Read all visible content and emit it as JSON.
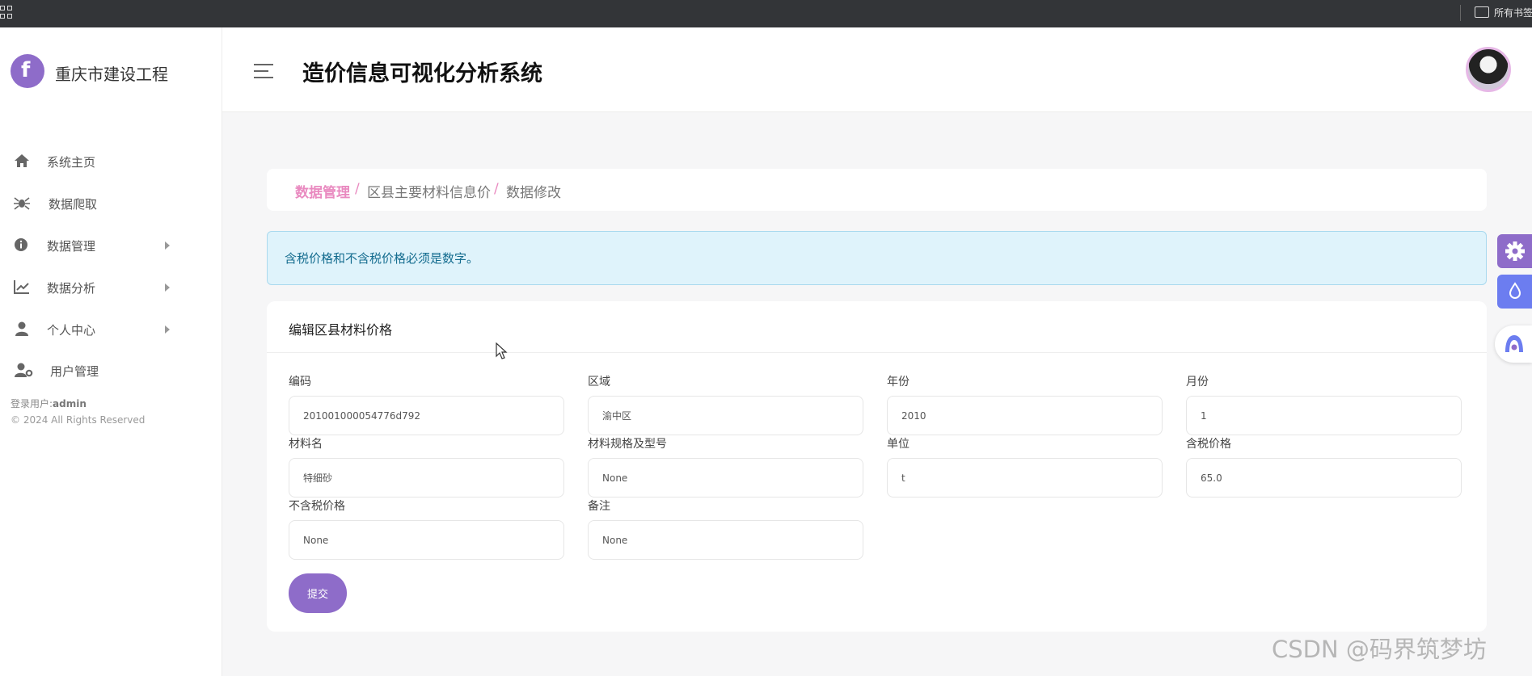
{
  "browser": {
    "bookmarks_label": "所有书签"
  },
  "sidebar": {
    "brand": "重庆市建设工程",
    "items": [
      {
        "label": "系统主页",
        "icon": "home-icon",
        "has_submenu": false
      },
      {
        "label": "数据爬取",
        "icon": "spider-icon",
        "has_submenu": false
      },
      {
        "label": "数据管理",
        "icon": "info-icon",
        "has_submenu": true
      },
      {
        "label": "数据分析",
        "icon": "chart-line-icon",
        "has_submenu": true
      },
      {
        "label": "个人中心",
        "icon": "user-icon",
        "has_submenu": true
      },
      {
        "label": "用户管理",
        "icon": "user-gear-icon",
        "has_submenu": false
      }
    ],
    "login_prefix": "登录用户:",
    "login_user": "admin",
    "copyright": "© 2024 All Rights Reserved"
  },
  "header": {
    "title": "造价信息可视化分析系统"
  },
  "breadcrumb": {
    "root": "数据管理",
    "parent": "区县主要材料信息价",
    "current": "数据修改",
    "separator": "/"
  },
  "alert": {
    "message": "含税价格和不含税价格必须是数字。"
  },
  "form": {
    "title": "编辑区县材料价格",
    "fields": [
      {
        "label": "编码",
        "value": "201001000054776d792"
      },
      {
        "label": "区域",
        "value": "渝中区"
      },
      {
        "label": "年份",
        "value": "2010"
      },
      {
        "label": "月份",
        "value": "1"
      },
      {
        "label": "材料名",
        "value": "特细砂"
      },
      {
        "label": "材料规格及型号",
        "value": "None"
      },
      {
        "label": "单位",
        "value": "t"
      },
      {
        "label": "含税价格",
        "value": "65.0"
      },
      {
        "label": "不含税价格",
        "value": "None"
      },
      {
        "label": "备注",
        "value": "None"
      }
    ],
    "submit_label": "提交"
  },
  "watermark": "CSDN @码界筑梦坊",
  "colors": {
    "accent": "#8e6cc9",
    "breadcrumb_active": "#e98ac0",
    "alert_bg": "#dff3fb",
    "alert_text": "#146c8f",
    "theme_button": "#6c7df0"
  }
}
